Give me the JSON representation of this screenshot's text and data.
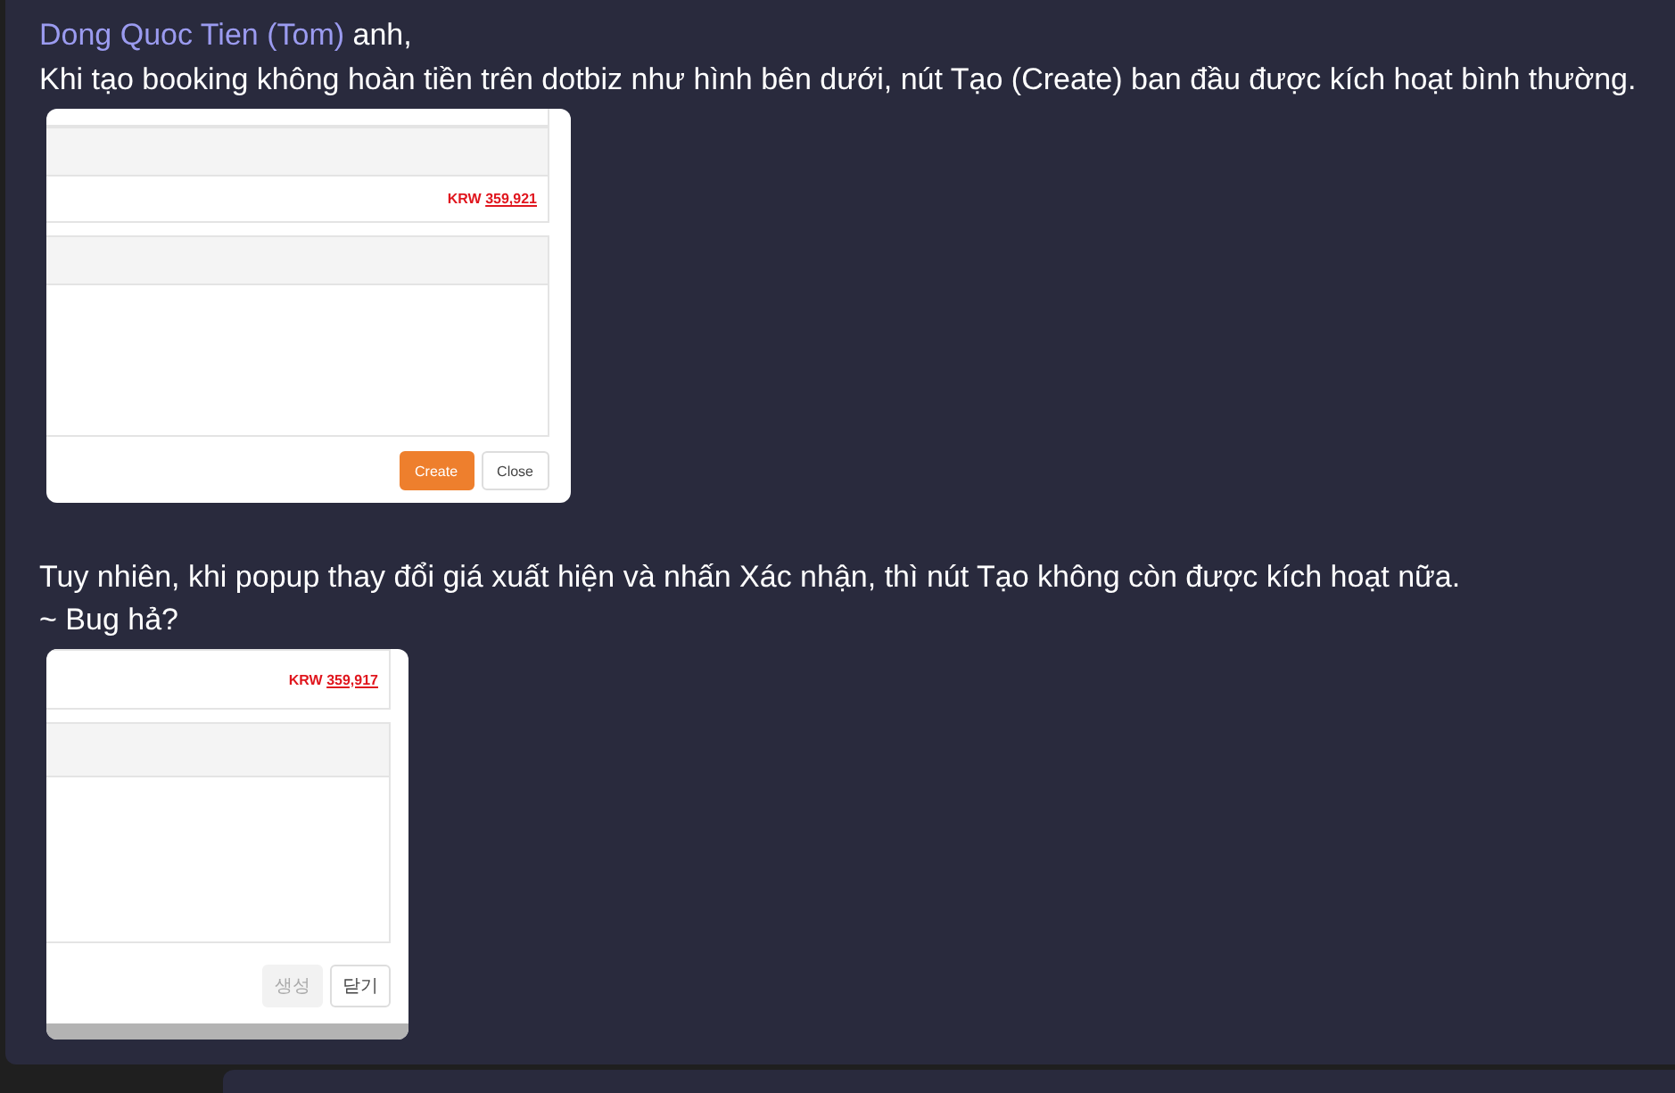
{
  "message": {
    "mention": "Dong Quoc Tien (Tom)",
    "greeting": " anh,",
    "paragraphs": [
      {
        "lines": [
          "Khi tạo booking không hoàn tiền trên dotbiz như hình bên dưới, nút Tạo (Create) ban đầu được kích hoạt bình thường."
        ],
        "screenshot": {
          "currency": "KRW",
          "amount": "359,921",
          "buttons": [
            {
              "label": "Create",
              "kind": "primary",
              "disabled": false
            },
            {
              "label": "Close",
              "kind": "secondary",
              "disabled": false
            }
          ]
        }
      },
      {
        "lines": [
          "Tuy nhiên, khi popup thay đổi giá xuất hiện và nhấn Xác nhận, thì nút Tạo không còn được kích hoạt nữa.",
          "~ Bug hả?"
        ],
        "screenshot": {
          "currency": "KRW",
          "amount": "359,917",
          "buttons": [
            {
              "label": "생성",
              "kind": "primary",
              "disabled": true
            },
            {
              "label": "닫기",
              "kind": "secondary",
              "disabled": false
            }
          ]
        }
      }
    ]
  }
}
